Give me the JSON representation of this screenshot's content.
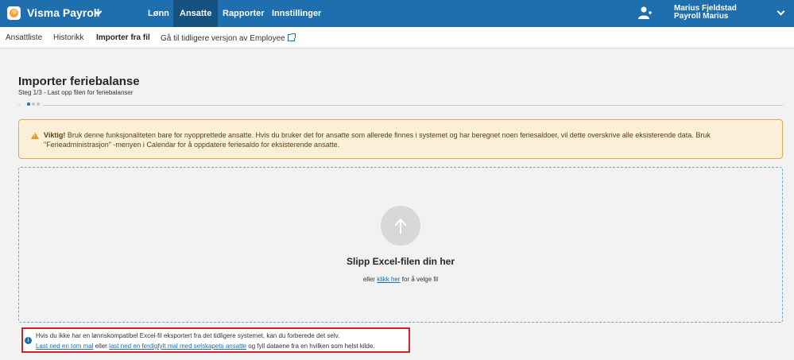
{
  "header": {
    "app_title": "Visma Payroll",
    "nav": [
      "Lønn",
      "Ansatte",
      "Rapporter",
      "Innstillinger"
    ],
    "active_nav": "Ansatte",
    "user_name": "Marius Fjeldstad",
    "company": "Payroll Marius",
    "brand_color": "#1f6fae"
  },
  "subnav": {
    "items": [
      "Ansattliste",
      "Historikk",
      "Importer fra fil",
      "Gå til tidligere versjon av Employee"
    ],
    "active": "Importer fra fil"
  },
  "page": {
    "title": "Importer feriebalanse",
    "step": "Steg 1/3 - Last opp filen for feriebalanser"
  },
  "warning": {
    "label": "Viktig!",
    "text": "Bruk denne funksjonaliteten bare for nyopprettede ansatte. Hvis du bruker det for ansatte som allerede finnes i systemet og har beregnet noen feriesaldoer, vil dette overskrive alle eksisterende data. Bruk \"Ferieadministrasjon\" -menyen i Calendar for å oppdatere feriesaldo for eksisterende ansatte."
  },
  "dropzone": {
    "title": "Slipp Excel-filen din her",
    "sub_prefix": "eller",
    "sub_link": "klikk her",
    "sub_suffix": "for å velge fil"
  },
  "info": {
    "line1": "Hvis du ikke har en lønnskompatibel Excel-fil eksportert fra det tidligere systemet, kan du forberede det selv.",
    "link1": "Last ned en tom mal",
    "between": "eller",
    "link2": "last ned en ferdigfylt mal med selskapets ansatte",
    "suffix": "og fyll dataene fra en hvilken som helst kilde."
  }
}
